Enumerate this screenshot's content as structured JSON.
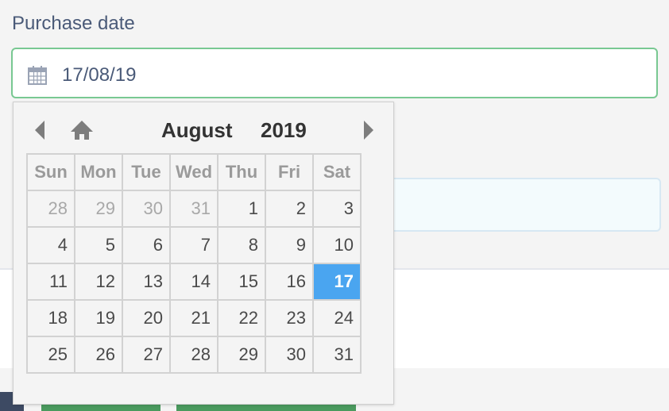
{
  "field": {
    "label": "Purchase date",
    "value": "17/08/19"
  },
  "calendar": {
    "month": "August",
    "year": "2019",
    "weekdays": [
      "Sun",
      "Mon",
      "Tue",
      "Wed",
      "Thu",
      "Fri",
      "Sat"
    ],
    "weeks": [
      [
        "28",
        "29",
        "30",
        "31",
        "1",
        "2",
        "3"
      ],
      [
        "4",
        "5",
        "6",
        "7",
        "8",
        "9",
        "10"
      ],
      [
        "11",
        "12",
        "13",
        "14",
        "15",
        "16",
        "17"
      ],
      [
        "18",
        "19",
        "20",
        "21",
        "22",
        "23",
        "24"
      ],
      [
        "25",
        "26",
        "27",
        "28",
        "29",
        "30",
        "31"
      ]
    ],
    "selected_day": "17",
    "icons": {
      "prev": "left-arrow-icon",
      "home": "home-icon",
      "next": "right-arrow-icon",
      "field": "calendar-icon"
    },
    "colors": {
      "selected": "#4aa5f0",
      "input_border": "#79c892"
    }
  }
}
